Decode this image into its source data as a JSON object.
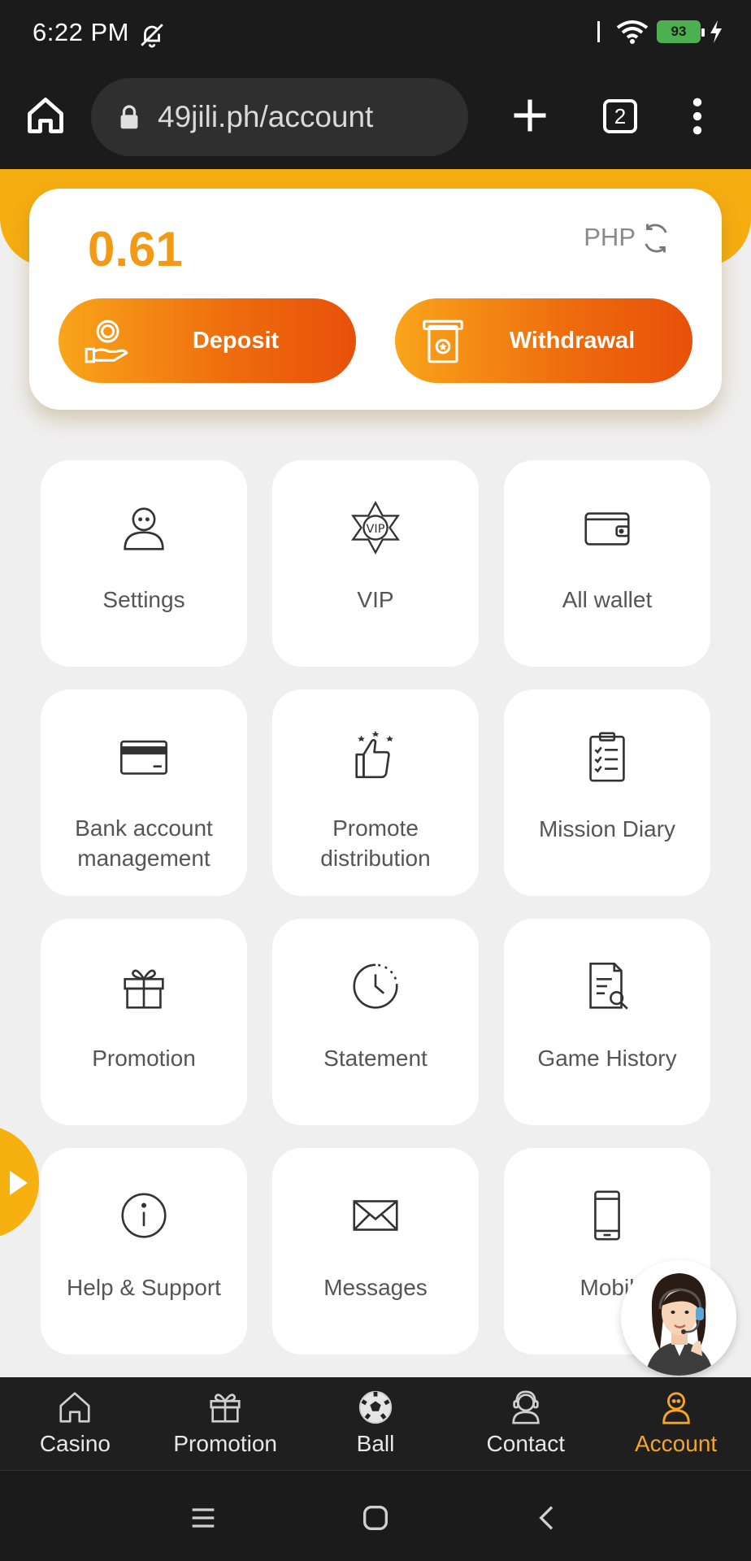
{
  "status_bar": {
    "time": "6:22 PM",
    "battery": "93",
    "icons": [
      "bell-off-icon",
      "wifi-icon",
      "battery-icon",
      "charging-icon"
    ]
  },
  "browser": {
    "url": "49jili.ph/account",
    "tab_count": "2"
  },
  "balance": {
    "amount": "0.61",
    "currency": "PHP",
    "deposit_label": "Deposit",
    "withdraw_label": "Withdrawal"
  },
  "menu": {
    "tiles": [
      {
        "label": "Settings",
        "icon": "user-icon"
      },
      {
        "label": "VIP",
        "icon": "vip-star-icon"
      },
      {
        "label": "All wallet",
        "icon": "wallet-icon"
      },
      {
        "label": "Bank account management",
        "icon": "card-icon"
      },
      {
        "label": "Promote distribution",
        "icon": "thumbs-up-icon"
      },
      {
        "label": "Mission Diary",
        "icon": "clipboard-icon"
      },
      {
        "label": "Promotion",
        "icon": "gift-icon"
      },
      {
        "label": "Statement",
        "icon": "clock-icon"
      },
      {
        "label": "Game History",
        "icon": "document-search-icon"
      },
      {
        "label": "Help & Support",
        "icon": "info-icon"
      },
      {
        "label": "Messages",
        "icon": "envelope-icon"
      },
      {
        "label": "Mobil",
        "icon": "phone-icon"
      }
    ]
  },
  "bottom_nav": {
    "items": [
      {
        "label": "Casino",
        "icon": "home-icon"
      },
      {
        "label": "Promotion",
        "icon": "gift-icon"
      },
      {
        "label": "Ball",
        "icon": "soccer-ball-icon"
      },
      {
        "label": "Contact",
        "icon": "headset-icon"
      },
      {
        "label": "Account",
        "icon": "user-icon"
      }
    ],
    "active": "Account"
  },
  "colors": {
    "accent": "#f29a16",
    "band": "#f5ad11",
    "button_start": "#f9a51a",
    "button_end": "#e8500a",
    "nav_active": "#f5a623"
  }
}
